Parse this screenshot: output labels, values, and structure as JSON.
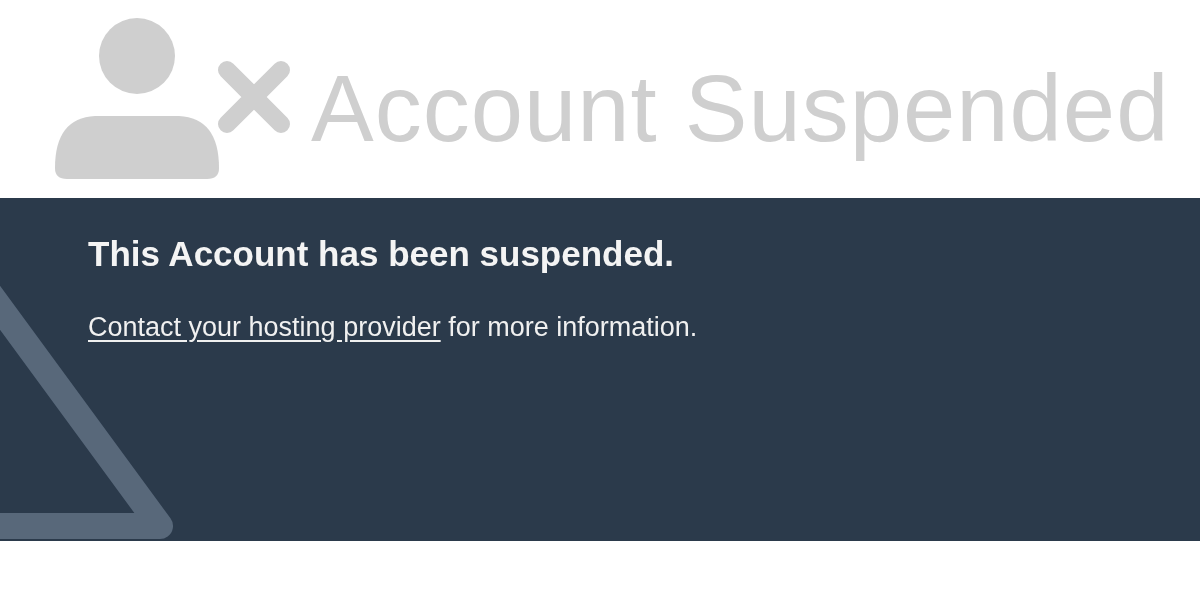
{
  "header": {
    "title": "Account Suspended"
  },
  "notice": {
    "heading": "This Account has been suspended.",
    "link": "Contact your hosting provider",
    "text": " for more information."
  }
}
